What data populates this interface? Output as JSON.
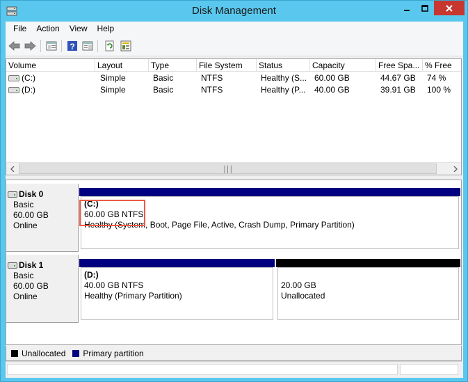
{
  "window": {
    "title": "Disk Management"
  },
  "menu": [
    "File",
    "Action",
    "View",
    "Help"
  ],
  "toolbar": {
    "icons": [
      "back-arrow-icon",
      "forward-arrow-icon",
      "show-hide-console-tree-icon",
      "help-icon",
      "show-action-pane-icon",
      "refresh-icon",
      "properties-icon"
    ]
  },
  "volume_list": {
    "columns": [
      "Volume",
      "Layout",
      "Type",
      "File System",
      "Status",
      "Capacity",
      "Free Spa...",
      "% Free"
    ],
    "rows": [
      [
        "(C:)",
        "Simple",
        "Basic",
        "NTFS",
        "Healthy (S...",
        "60.00 GB",
        "44.67 GB",
        "74 %"
      ],
      [
        "(D:)",
        "Simple",
        "Basic",
        "NTFS",
        "Healthy (P...",
        "40.00 GB",
        "39.91 GB",
        "100 %"
      ]
    ]
  },
  "disks": [
    {
      "name": "Disk 0",
      "type": "Basic",
      "size": "60.00 GB",
      "status": "Online",
      "partitions": [
        {
          "name": "(C:)",
          "size_fs": "60.00 GB NTFS",
          "status": "Healthy (System, Boot, Page File, Active, Crash Dump, Primary Partition)",
          "kind": "primary"
        }
      ]
    },
    {
      "name": "Disk 1",
      "type": "Basic",
      "size": "60.00 GB",
      "status": "Online",
      "partitions": [
        {
          "name": "(D:)",
          "size_fs": "40.00 GB NTFS",
          "status": "Healthy (Primary Partition)",
          "kind": "primary"
        },
        {
          "name": "",
          "size_fs": "20.00 GB",
          "status": "Unallocated",
          "kind": "unallocated"
        }
      ]
    }
  ],
  "legend": [
    {
      "label": "Unallocated",
      "color": "#000000"
    },
    {
      "label": "Primary partition",
      "color": "#000080"
    }
  ],
  "colors": {
    "title_bar": "#5ac8ee",
    "primary": "#000080",
    "unallocated": "#000000",
    "close_button": "#c7372f",
    "highlight": "#ec5b43"
  }
}
